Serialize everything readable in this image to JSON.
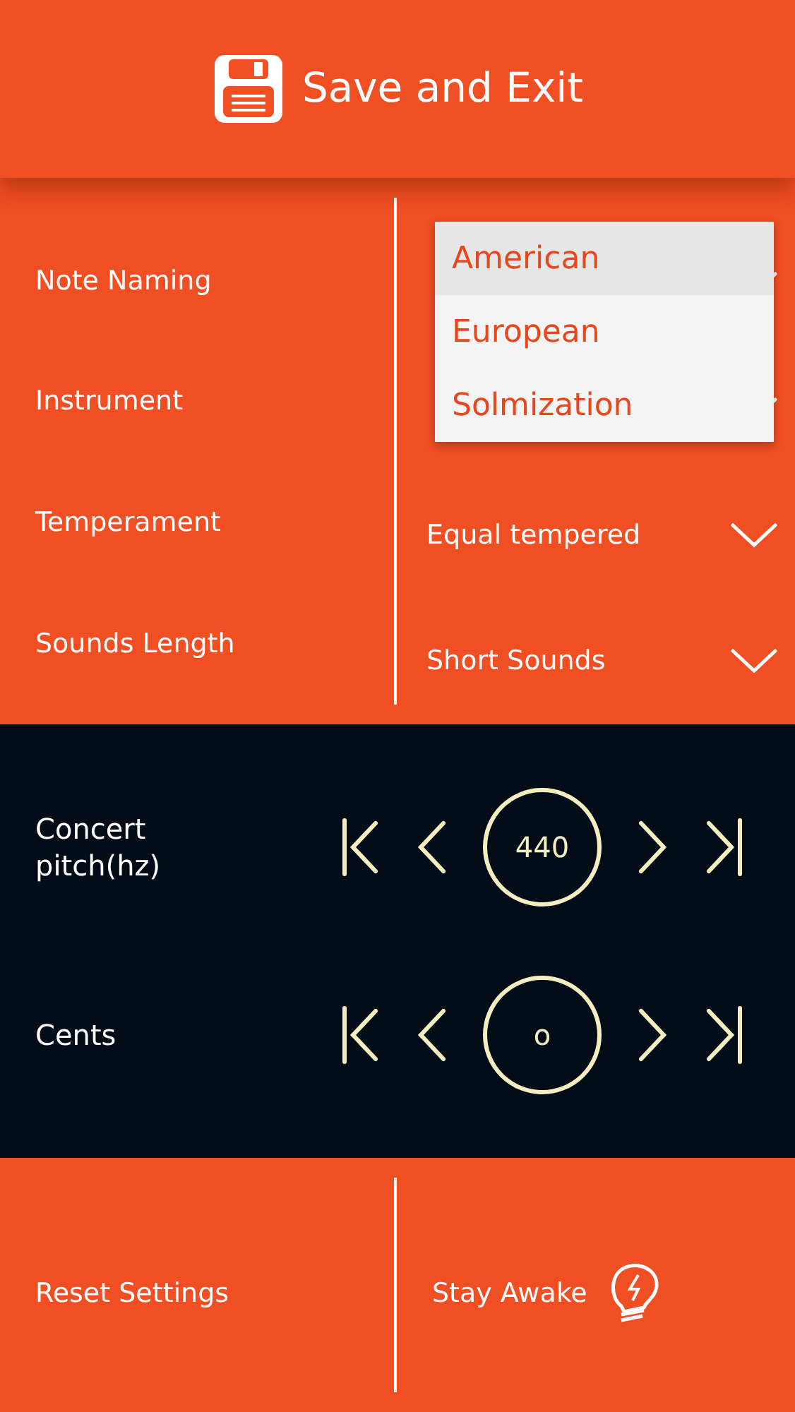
{
  "header": {
    "title": "Save and Exit"
  },
  "settings": [
    {
      "label": "Note Naming"
    },
    {
      "label": "Instrument"
    },
    {
      "label": "Temperament",
      "value": "Equal tempered"
    },
    {
      "label": "Sounds Length",
      "value": "Short Sounds"
    }
  ],
  "dropdown": {
    "options": [
      {
        "label": "American",
        "selected": true
      },
      {
        "label": "European",
        "selected": false
      },
      {
        "label": "Solmization",
        "selected": false
      }
    ]
  },
  "steppers": [
    {
      "label": "Concert pitch(hz)",
      "value": "440"
    },
    {
      "label": "Cents",
      "value": "o"
    }
  ],
  "footer": {
    "reset": "Reset Settings",
    "awake": "Stay Awake"
  }
}
